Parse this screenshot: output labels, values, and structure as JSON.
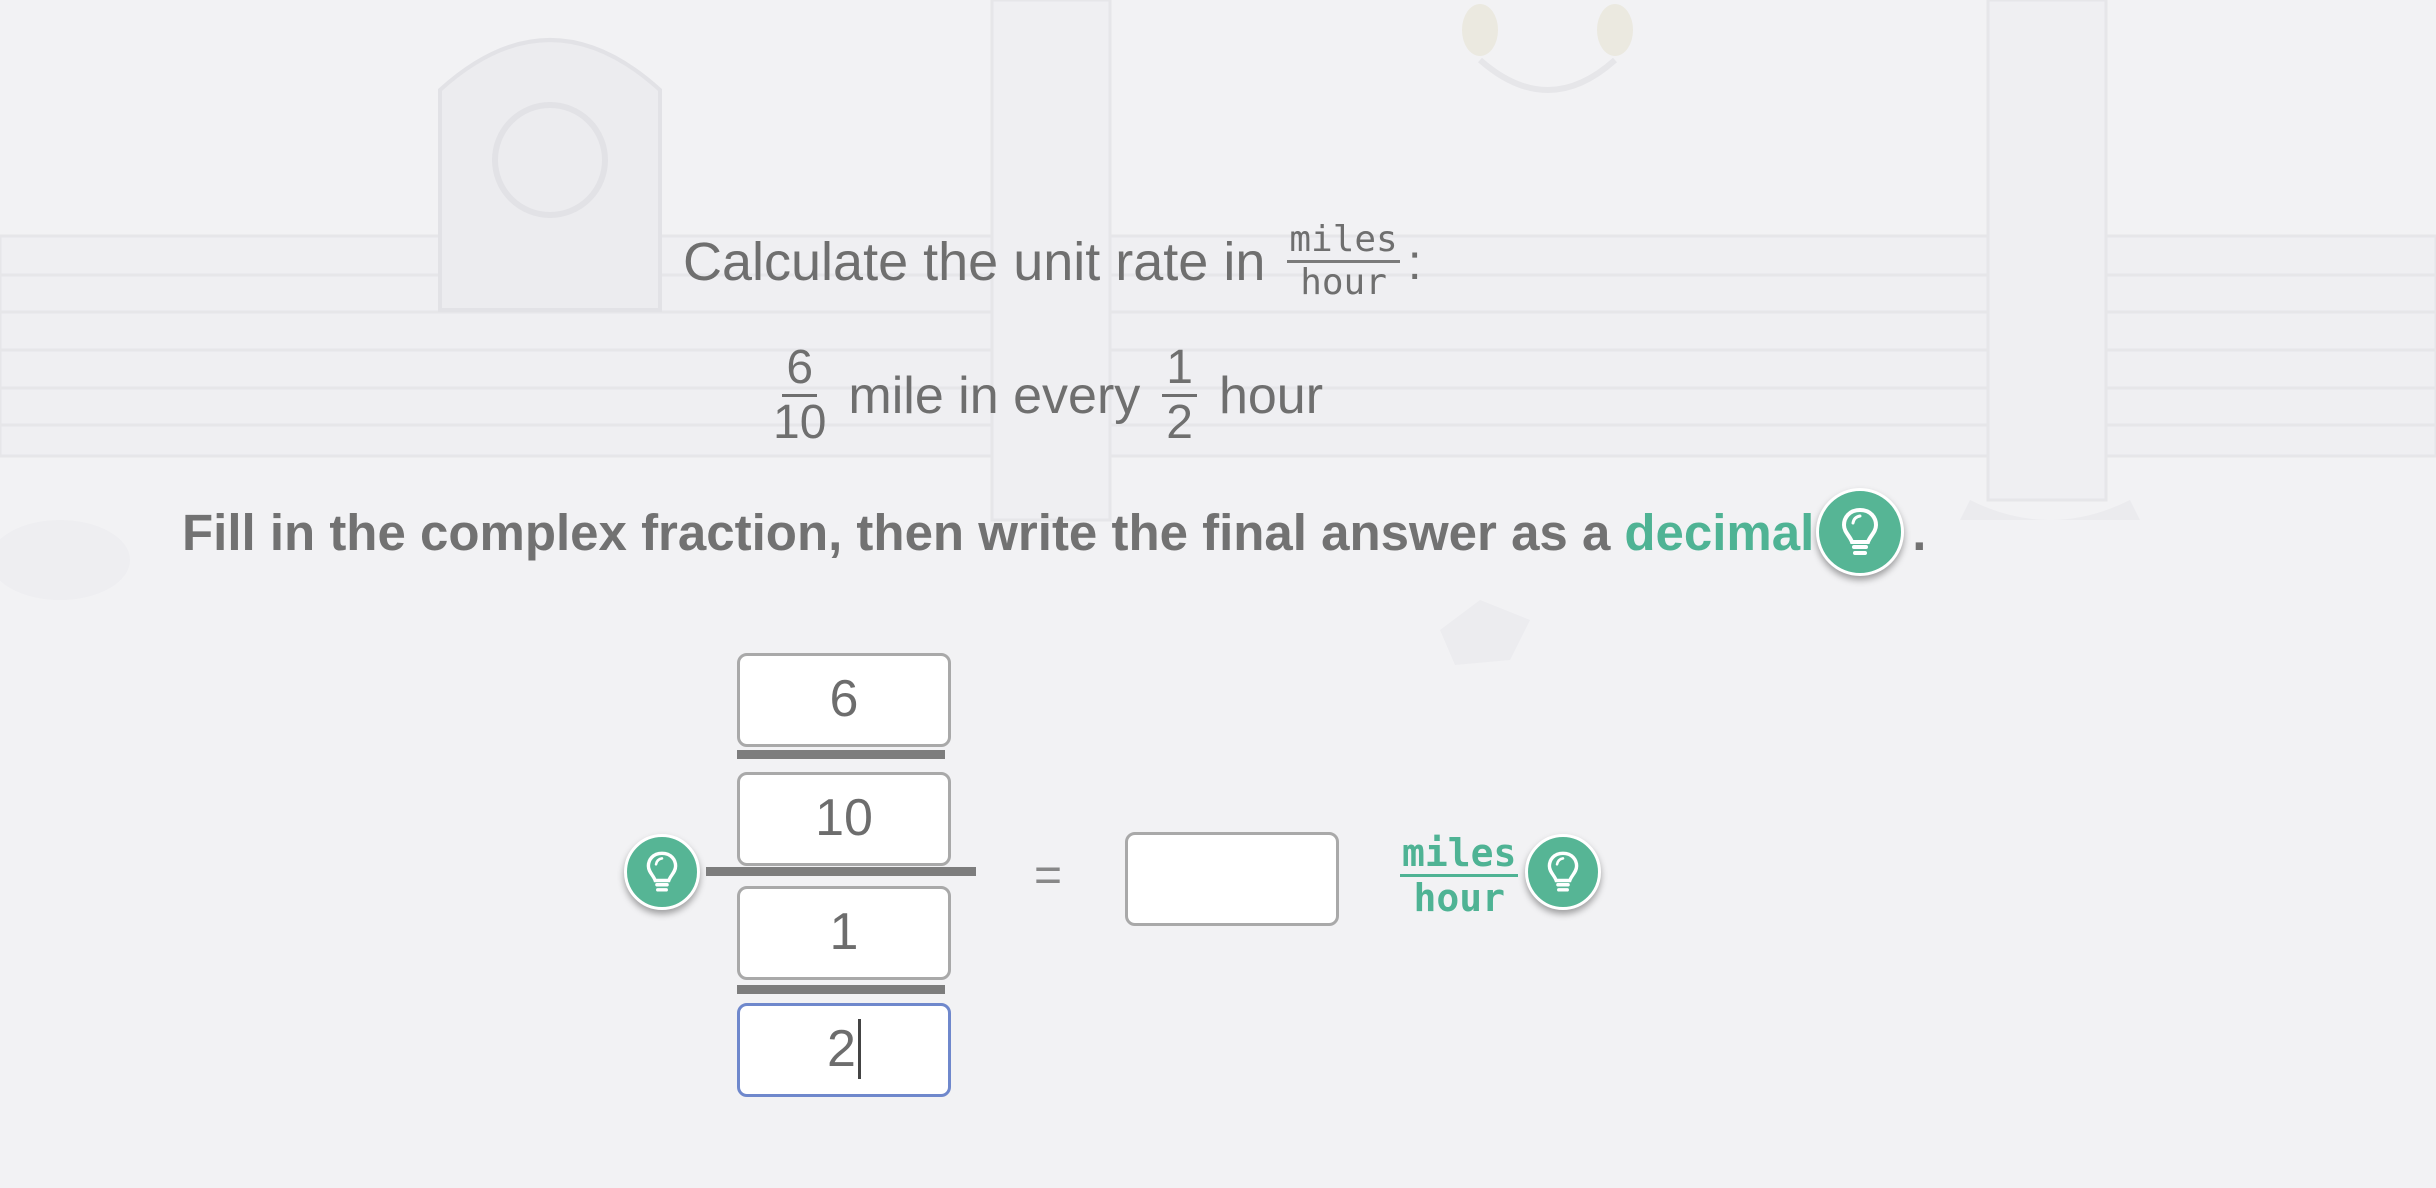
{
  "header": {
    "prompt": "Calculate the unit rate in",
    "unit_numerator": "miles",
    "unit_denominator": "hour",
    "suffix": ":"
  },
  "problem": {
    "distance_numerator": "6",
    "distance_denominator": "10",
    "middle_text": "mile in every",
    "time_numerator": "1",
    "time_denominator": "2",
    "end_text": "hour"
  },
  "instruction": {
    "text": "Fill in the complex fraction, then write the final answer as a",
    "keyword": "decimal",
    "period": "."
  },
  "complex_fraction": {
    "top_numerator": "6",
    "top_denominator": "10",
    "bottom_numerator": "1",
    "bottom_denominator": "2"
  },
  "equals": "=",
  "answer": {
    "value": "",
    "unit_numerator": "miles",
    "unit_denominator": "hour"
  },
  "icons": {
    "hint": "lightbulb-icon"
  },
  "colors": {
    "accent": "#4fb394",
    "focus_border": "#6f88cc",
    "background": "#f2f2f4"
  }
}
